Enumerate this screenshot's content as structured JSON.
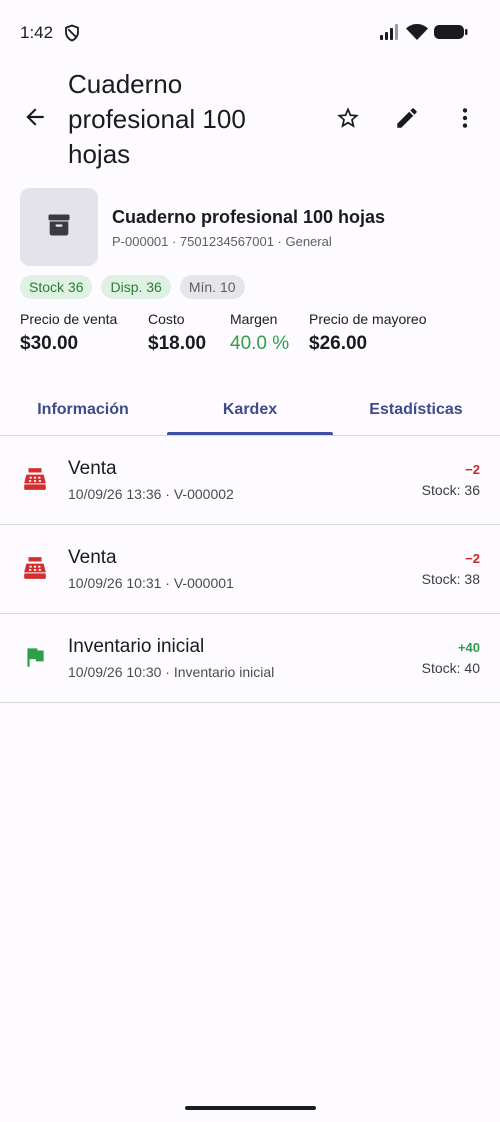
{
  "status_bar": {
    "time": "1:42"
  },
  "appbar": {
    "title": "Cuaderno profesional 100 hojas",
    "back_icon": "arrow-back-icon",
    "actions": [
      "star-outline-icon",
      "edit-pencil-icon",
      "more-vert-icon"
    ]
  },
  "product": {
    "name": "Cuaderno profesional 100 hojas",
    "meta": "P-000001 · 7501234567001 · General",
    "thumb_icon": "archive-box-icon"
  },
  "chips": [
    {
      "label": "Stock 36"
    },
    {
      "label": "Disp. 36"
    },
    {
      "label": "Mín. 10"
    }
  ],
  "prices": [
    {
      "label": "Precio de venta",
      "value": "$30.00"
    },
    {
      "label": "Costo",
      "value": "$18.00"
    },
    {
      "label": "Margen",
      "value": "40.0 %"
    },
    {
      "label": "Precio de mayoreo",
      "value": "$26.00"
    }
  ],
  "tabs": [
    {
      "label": "Información"
    },
    {
      "label": "Kardex"
    },
    {
      "label": "Estadísticas"
    }
  ],
  "selected_tab": "Kardex",
  "kardex": [
    {
      "title": "Venta",
      "subtitle": "10/09/26 13:36 · V-000002",
      "qty": "−2",
      "stock": "Stock: 36",
      "icon": "cash-register-icon"
    },
    {
      "title": "Venta",
      "subtitle": "10/09/26 10:31 · V-000001",
      "qty": "−2",
      "stock": "Stock: 38",
      "icon": "cash-register-icon"
    },
    {
      "title": "Inventario inicial",
      "subtitle": "10/09/26 10:30 · Inventario inicial",
      "qty": "+40",
      "stock": "Stock: 40",
      "icon": "flag-icon"
    }
  ],
  "colors": {
    "accent": "#3f4fa3",
    "negative": "#c62828",
    "positive": "#2e9e4a"
  }
}
